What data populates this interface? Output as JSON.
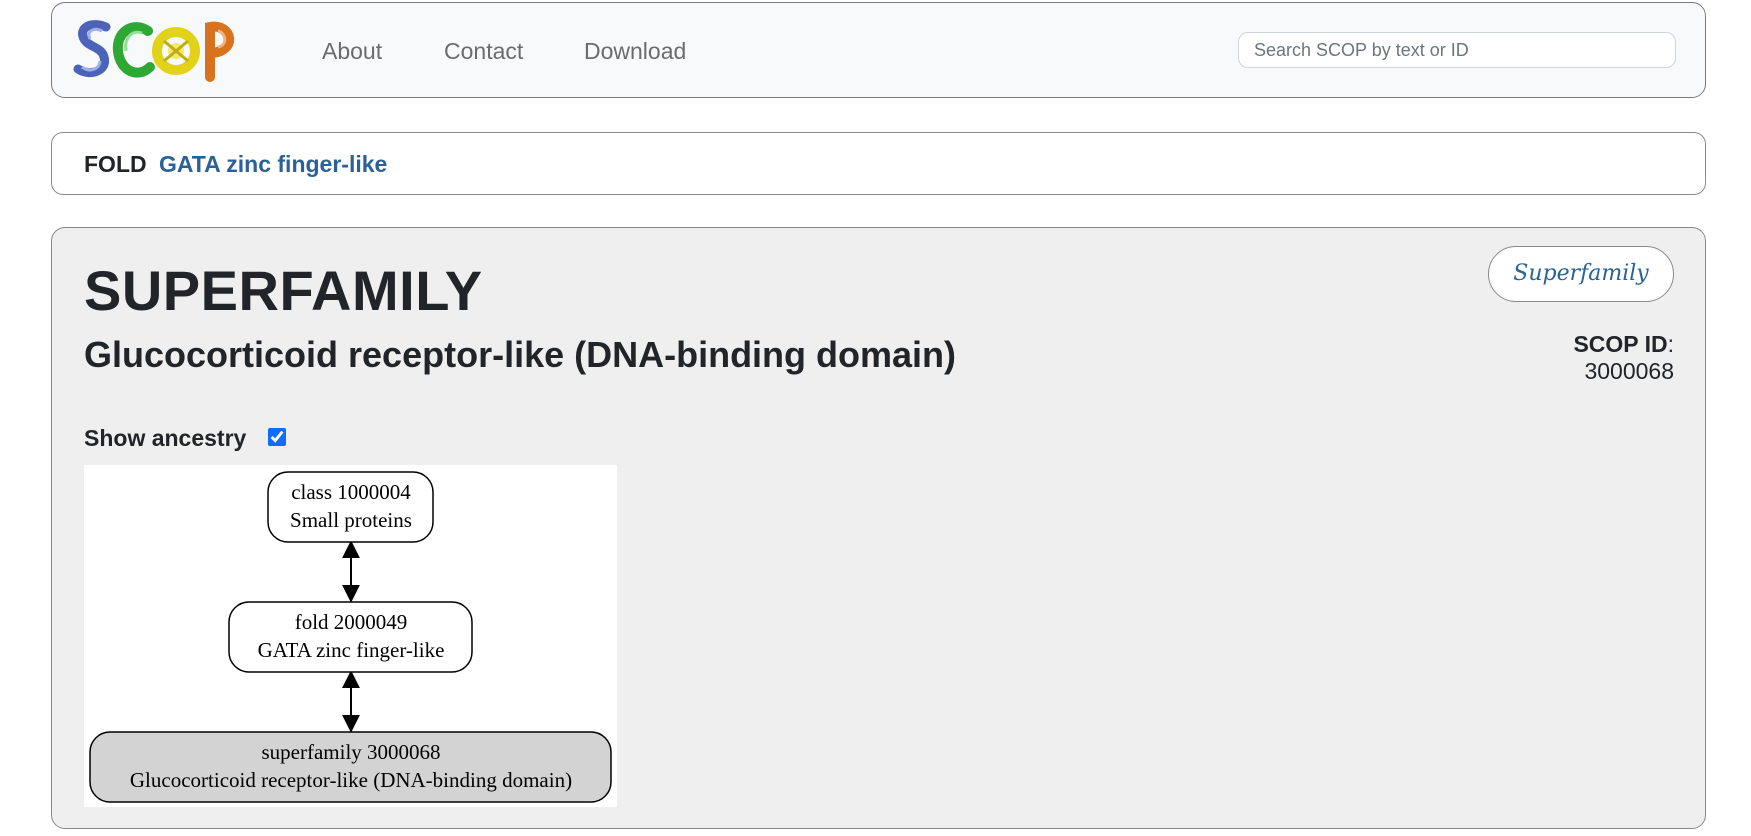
{
  "navbar": {
    "logo_text": "SCOP",
    "logo_colors": [
      "#4b63b8",
      "#2da832",
      "#e2d21a",
      "#d8721e"
    ],
    "links": [
      "About",
      "Contact",
      "Download"
    ],
    "search_placeholder": "Search SCOP by text or ID"
  },
  "breadcrumb": {
    "level": "FOLD",
    "name": "GATA zinc finger-like"
  },
  "entry": {
    "level_title": "SUPERFAMILY",
    "name": "Glucocorticoid receptor-like (DNA-binding domain)",
    "type_badge": "Superfamily",
    "scop_id_label": "SCOP ID",
    "scop_id_sep": ": ",
    "scop_id_value": "3000068"
  },
  "ancestry": {
    "label": "Show ancestry",
    "checked": true,
    "nodes": [
      {
        "line1": "class 1000004",
        "line2": "Small proteins",
        "highlighted": false
      },
      {
        "line1": "fold 2000049",
        "line2": "GATA zinc finger-like",
        "highlighted": false
      },
      {
        "line1": "superfamily 3000068",
        "line2": "Glucocorticoid receptor-like (DNA-binding domain)",
        "highlighted": true
      }
    ]
  },
  "colors": {
    "link": "#2a6196",
    "card_bg": "#efefef",
    "highlight_node": "#d3d3d3"
  }
}
